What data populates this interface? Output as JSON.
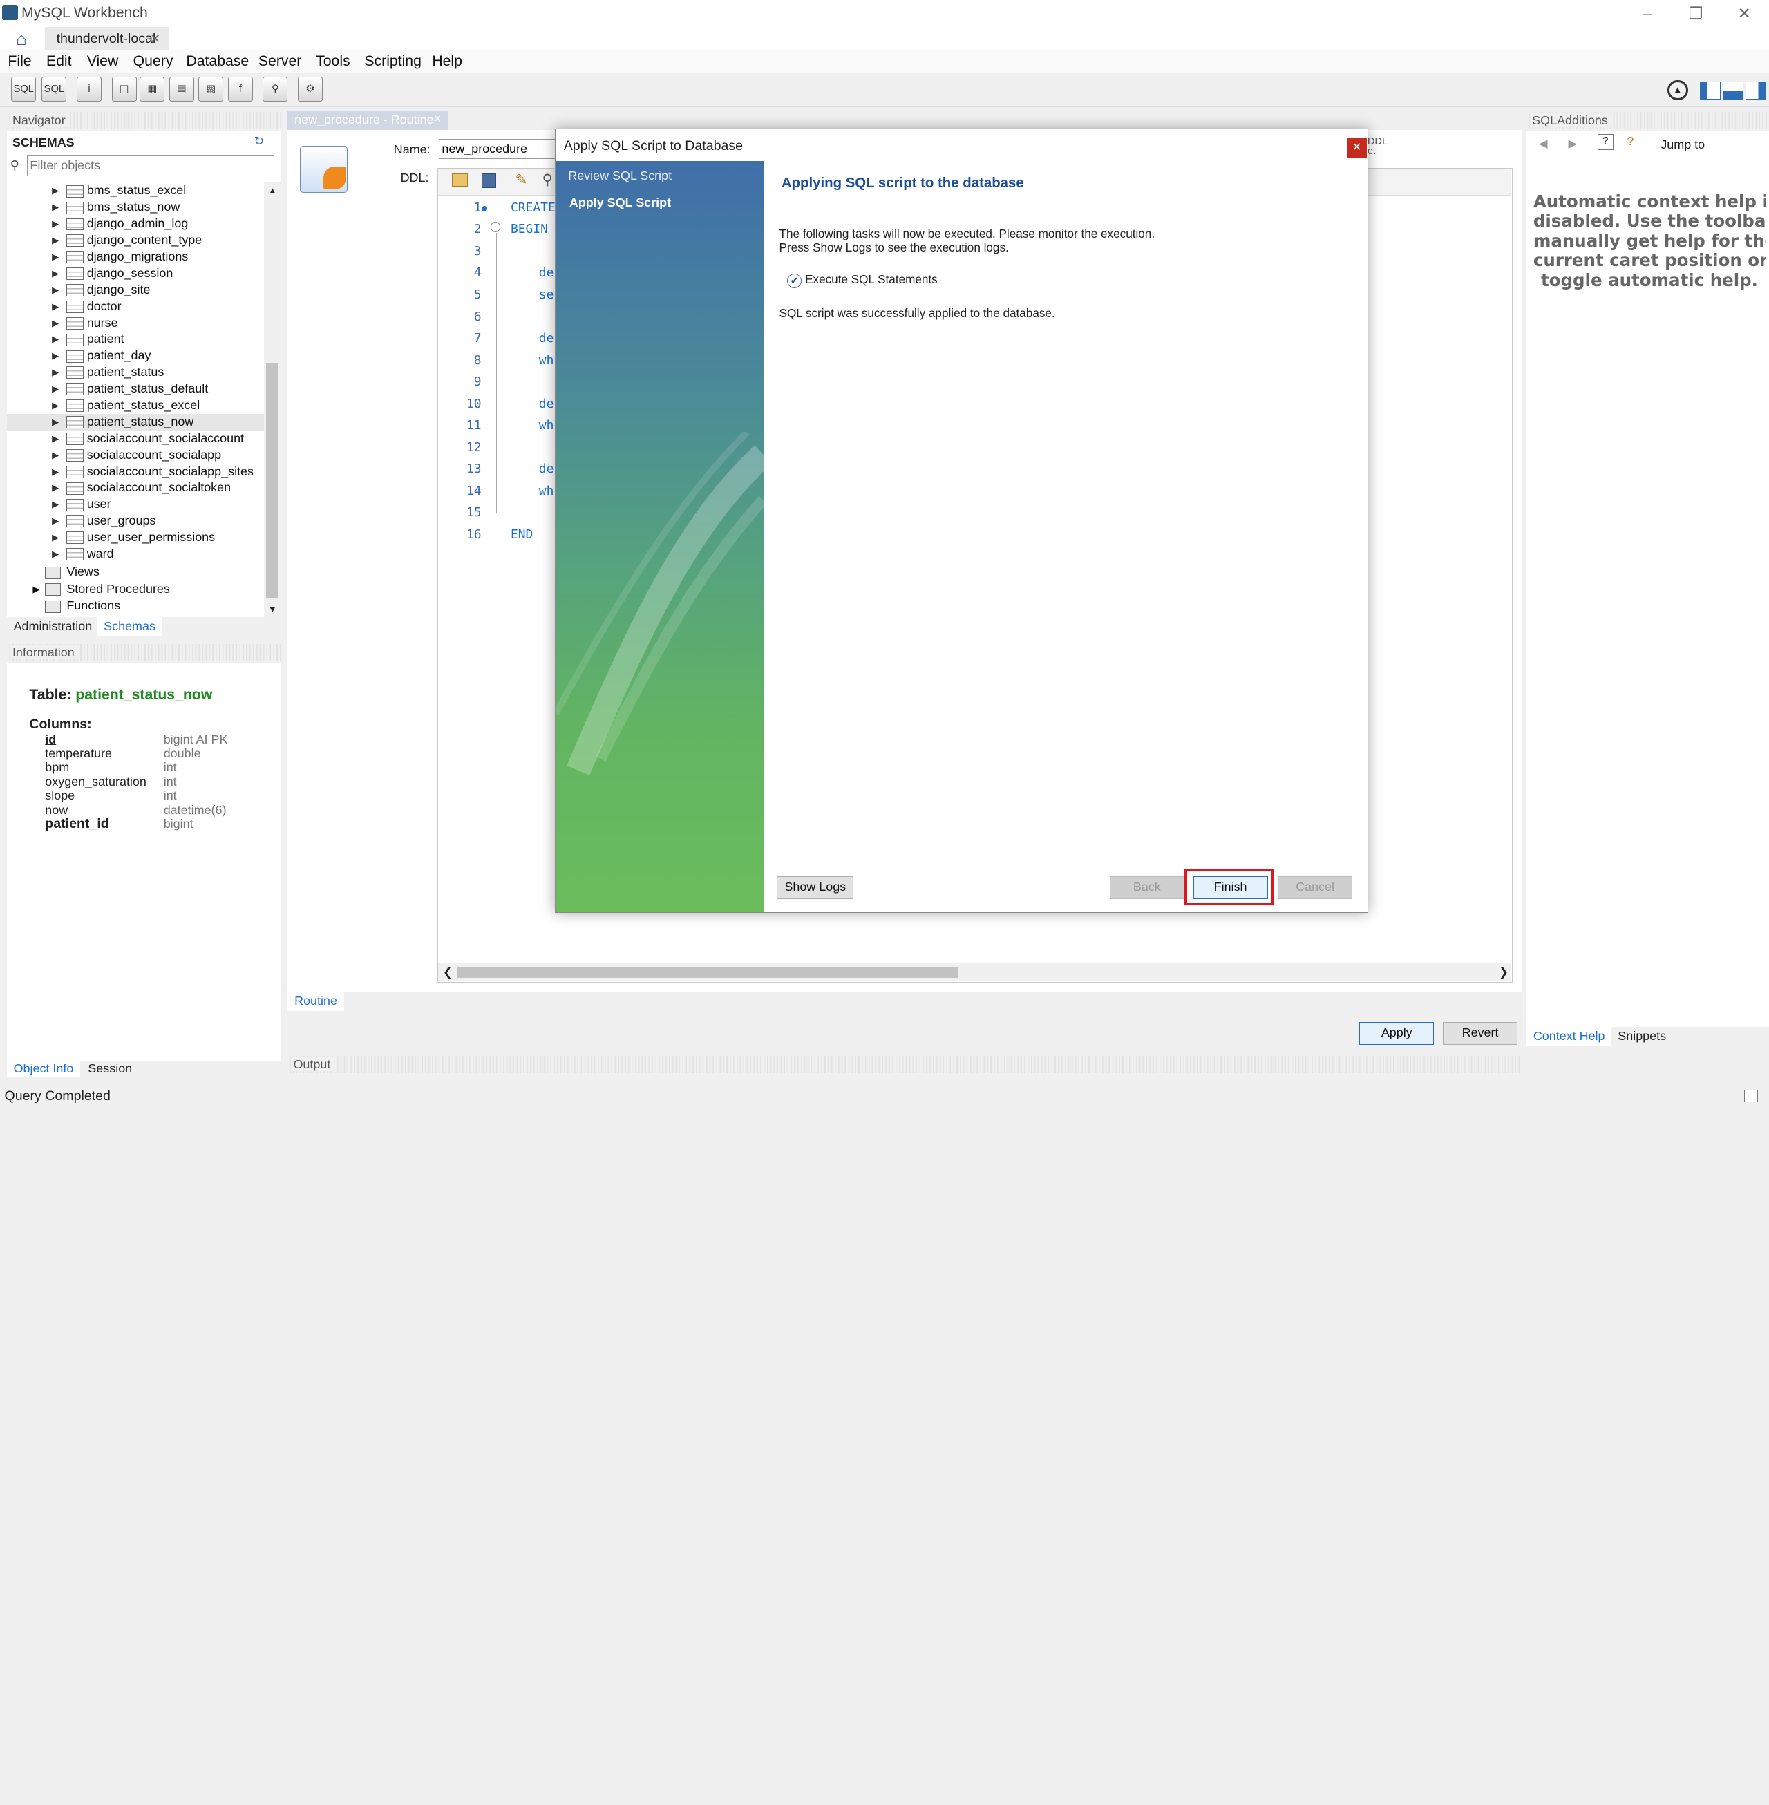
{
  "window": {
    "title": "MySQL Workbench",
    "connection_tab": "thundervolt-local"
  },
  "menu": [
    "File",
    "Edit",
    "View",
    "Query",
    "Database",
    "Server",
    "Tools",
    "Scripting",
    "Help"
  ],
  "navigator": {
    "header": "Navigator",
    "schemas_label": "SCHEMAS",
    "filter_placeholder": "Filter objects",
    "tables": [
      "bms_status_excel",
      "bms_status_now",
      "django_admin_log",
      "django_content_type",
      "django_migrations",
      "django_session",
      "django_site",
      "doctor",
      "nurse",
      "patient",
      "patient_day",
      "patient_status",
      "patient_status_default",
      "patient_status_excel",
      "patient_status_now",
      "socialaccount_socialaccount",
      "socialaccount_socialapp",
      "socialaccount_socialapp_sites",
      "socialaccount_socialtoken",
      "user",
      "user_groups",
      "user_user_permissions",
      "ward"
    ],
    "folders": [
      "Views",
      "Stored Procedures",
      "Functions"
    ],
    "bottom_tabs": [
      "Administration",
      "Schemas"
    ]
  },
  "information": {
    "header": "Information",
    "table_prefix": "Table:",
    "table_name": "patient_status_now",
    "columns_label": "Columns:",
    "columns": [
      {
        "name": "id",
        "type": "bigint AI PK"
      },
      {
        "name": "temperature",
        "type": "double"
      },
      {
        "name": "bpm",
        "type": "int"
      },
      {
        "name": "oxygen_saturation",
        "type": "int"
      },
      {
        "name": "slope",
        "type": "int"
      },
      {
        "name": "now",
        "type": "datetime(6)"
      },
      {
        "name": "patient_id",
        "type": "bigint"
      }
    ],
    "bottom_tabs": [
      "Object Info",
      "Session"
    ]
  },
  "editor": {
    "tab": "new_procedure - Routine",
    "name_label": "Name:",
    "name_value": "new_procedure",
    "ddl_label": "DDL:",
    "ddl_hint": "DDL",
    "ddl_hint2": "e.",
    "lines": [
      {
        "n": "1",
        "t": "CREATE"
      },
      {
        "n": "2",
        "t": "BEGIN"
      },
      {
        "n": "3",
        "t": ""
      },
      {
        "n": "4",
        "t": "de"
      },
      {
        "n": "5",
        "t": "se"
      },
      {
        "n": "6",
        "t": ""
      },
      {
        "n": "7",
        "t": "de"
      },
      {
        "n": "8",
        "t": "wh"
      },
      {
        "n": "9",
        "t": ""
      },
      {
        "n": "10",
        "t": "de"
      },
      {
        "n": "11",
        "t": "wh"
      },
      {
        "n": "12",
        "t": ""
      },
      {
        "n": "13",
        "t": "de"
      },
      {
        "n": "14",
        "t": "wh"
      },
      {
        "n": "15",
        "t": ""
      },
      {
        "n": "16",
        "t": "END"
      }
    ],
    "bottom_tab": "Routine",
    "apply": "Apply",
    "revert": "Revert"
  },
  "output": {
    "header": "Output"
  },
  "sql_additions": {
    "header": "SQLAdditions",
    "jump_to": "Jump to",
    "help_lines": [
      "Automatic context help is",
      "disabled. Use the toolbar t",
      "manually get help for the",
      "current caret position or to",
      "toggle automatic help."
    ],
    "tabs": [
      "Context Help",
      "Snippets"
    ]
  },
  "dialog": {
    "title": "Apply SQL Script to Database",
    "steps": [
      "Review SQL Script",
      "Apply SQL Script"
    ],
    "heading": "Applying SQL script to the database",
    "desc1": "The following tasks will now be executed. Please monitor the execution.",
    "desc2": "Press Show Logs to see the execution logs.",
    "task": "Execute SQL Statements",
    "result": "SQL script was successfully applied to the database.",
    "buttons": {
      "show_logs": "Show Logs",
      "back": "Back",
      "finish": "Finish",
      "cancel": "Cancel"
    }
  },
  "status": "Query Completed",
  "colors": {
    "highlight": "#e0161e",
    "heading": "#1c4f96",
    "table_name": "#1f8a1f",
    "link_tab": "#1a6fd6"
  }
}
